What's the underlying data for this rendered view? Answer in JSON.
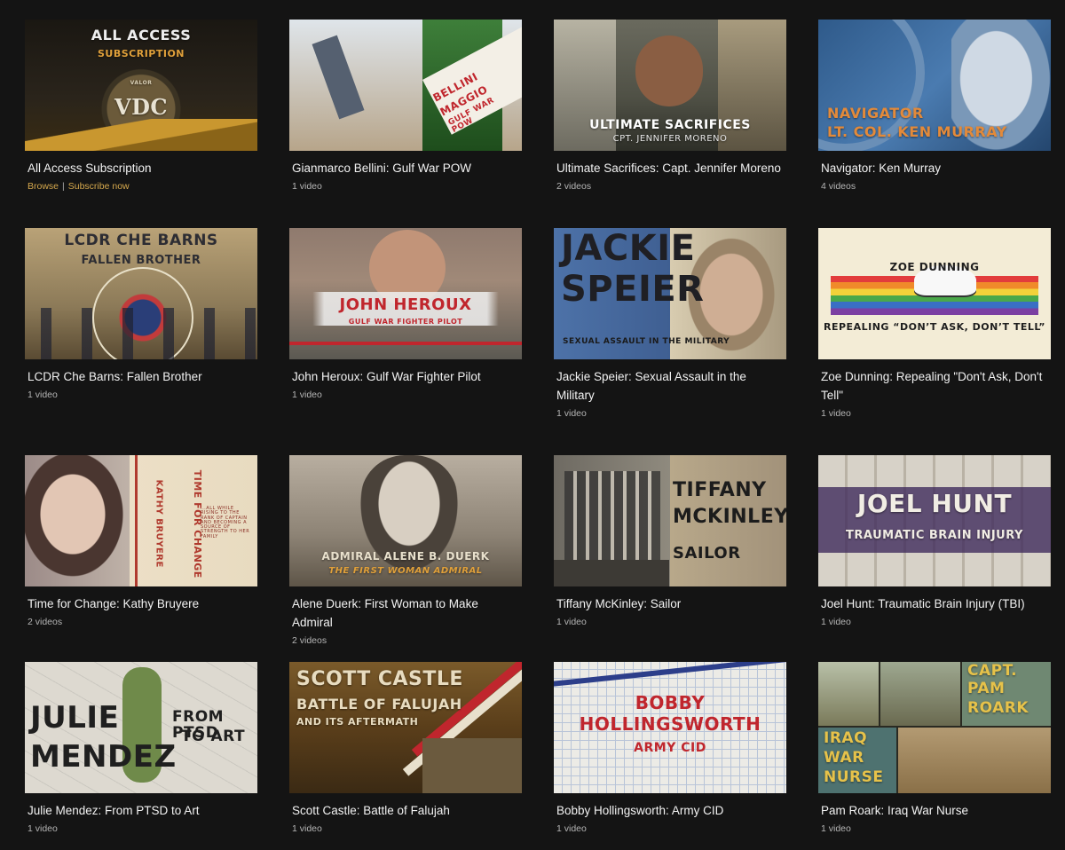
{
  "cards": [
    {
      "title": "All Access Subscription",
      "thumb_lines": [
        "ALL ACCESS",
        "SUBSCRIPTION",
        "VDC",
        "VALOR"
      ],
      "links": [
        "Browse",
        "Subscribe now"
      ]
    },
    {
      "title": "Gianmarco Bellini: Gulf War POW",
      "count": "1 video",
      "thumb_lines": [
        "BELLINI",
        "MAGGIO",
        "GULF WAR POW"
      ]
    },
    {
      "title": "Ultimate Sacrifices: Capt. Jennifer Moreno",
      "count": "2 videos",
      "thumb_lines": [
        "ULTIMATE SACRIFICES",
        "CPT. JENNIFER MORENO"
      ]
    },
    {
      "title": "Navigator: Ken Murray",
      "count": "4 videos",
      "thumb_lines": [
        "NAVIGATOR",
        "LT. COL. KEN MURRAY"
      ]
    },
    {
      "title": "LCDR Che Barns: Fallen Brother",
      "count": "1 video",
      "thumb_lines": [
        "LCDR CHE BARNS",
        "FALLEN BROTHER"
      ]
    },
    {
      "title": "John Heroux: Gulf War Fighter Pilot",
      "count": "1 video",
      "thumb_lines": [
        "JOHN HEROUX",
        "GULF WAR FIGHTER PILOT"
      ]
    },
    {
      "title": "Jackie Speier: Sexual Assault in the Military",
      "count": "1 video",
      "thumb_lines": [
        "JACKIE",
        "SPEIER",
        "SEXUAL ASSAULT IN THE MILITARY"
      ]
    },
    {
      "title": "Zoe Dunning: Repealing \"Don't Ask, Don't Tell\"",
      "count": "1 video",
      "thumb_lines": [
        "ZOE DUNNING",
        "REPEALING “DON’T ASK, DON’T TELL”"
      ]
    },
    {
      "title": "Time for Change: Kathy Bruyere",
      "count": "2 videos",
      "thumb_lines": [
        "TIME FOR CHANGE",
        "KATHY BRUYERE",
        "...ALL WHILE RISING TO THE RANK OF CAPTAIN AND BECOMING A SOURCE OF STRENGTH TO HER FAMILY"
      ]
    },
    {
      "title": "Alene Duerk: First Woman to Make Admiral",
      "count": "2 videos",
      "thumb_lines": [
        "ADMIRAL ALENE B. DUERK",
        "THE FIRST WOMAN ADMIRAL"
      ]
    },
    {
      "title": "Tiffany McKinley: Sailor",
      "count": "1 video",
      "thumb_lines": [
        "TIFFANY",
        "MCKINLEY",
        "SAILOR"
      ]
    },
    {
      "title": "Joel Hunt: Traumatic Brain Injury (TBI)",
      "count": "1 video",
      "thumb_lines": [
        "JOEL HUNT",
        "TRAUMATIC BRAIN INJURY"
      ]
    },
    {
      "title": "Julie Mendez: From PTSD to Art",
      "count": "1 video",
      "thumb_lines": [
        "JULIE",
        "MENDEZ",
        "FROM PTSD",
        "TO ART"
      ]
    },
    {
      "title": "Scott Castle: Battle of Falujah",
      "count": "1 video",
      "thumb_lines": [
        "SCOTT CASTLE",
        "BATTLE OF FALUJAH",
        "AND ITS AFTERMATH"
      ]
    },
    {
      "title": "Bobby Hollingsworth: Army CID",
      "count": "1 video",
      "thumb_lines": [
        "BOBBY",
        "HOLLINGSWORTH",
        "ARMY CID"
      ]
    },
    {
      "title": "Pam Roark: Iraq War Nurse",
      "count": "1 video",
      "thumb_lines": [
        "CAPT.",
        "PAM",
        "ROARK",
        "IRAQ",
        "WAR",
        "NURSE"
      ]
    }
  ],
  "colors": {
    "background": "#141414",
    "link": "#d5a84d",
    "meta": "#b5b5b5"
  }
}
